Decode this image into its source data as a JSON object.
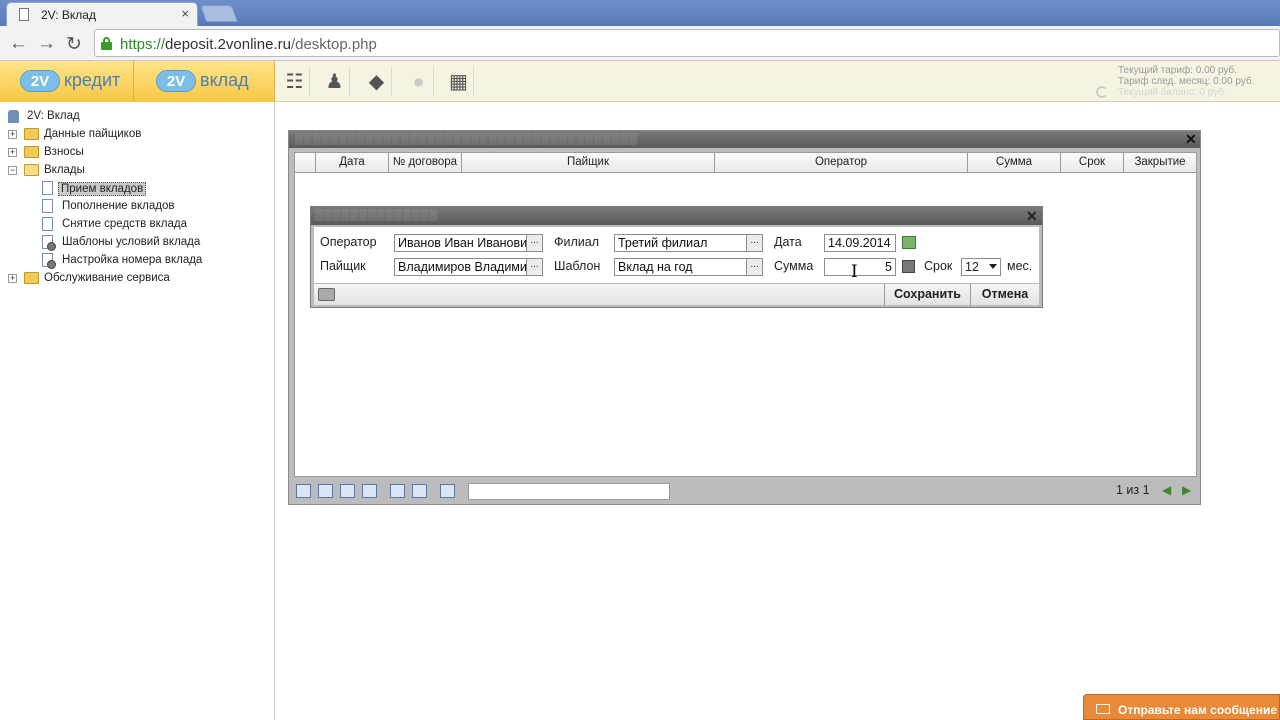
{
  "browser": {
    "tab_title": "2V: Вклад",
    "tab_close": "×",
    "url_protocol": "https://",
    "url_host": "deposit.2vonline.ru",
    "url_path": "/desktop.php"
  },
  "header": {
    "brand_tabs": [
      {
        "logo": "2V",
        "name": "кредит"
      },
      {
        "logo": "2V",
        "name": "вклад"
      }
    ],
    "tariff_lines": [
      "Текущий тариф: 0.00 руб.",
      "Тариф след. месяц: 0.00 руб.",
      "Текущий баланс: 0 руб."
    ]
  },
  "sidebar": {
    "root": "2V: Вклад",
    "items": [
      {
        "label": "Данные пайщиков"
      },
      {
        "label": "Взносы"
      },
      {
        "label": "Вклады"
      },
      {
        "label": "Прием вкладов"
      },
      {
        "label": "Пополнение вкладов"
      },
      {
        "label": "Снятие средств вклада"
      },
      {
        "label": "Шаблоны условий вклада"
      },
      {
        "label": "Настройка номера вклада"
      },
      {
        "label": "Обслуживание сервиса"
      }
    ]
  },
  "grid": {
    "columns": [
      "Дата",
      "№ договора",
      "Пайщик",
      "Оператор",
      "Сумма",
      "Срок",
      "Закрытие"
    ],
    "pager": "1 из 1"
  },
  "dialog": {
    "operator_label": "Оператор",
    "operator_value": "Иванов Иван Иванович",
    "branch_label": "Филиал",
    "branch_value": "Третий филиал",
    "date_label": "Дата",
    "date_value": "14.09.2014",
    "shareholder_label": "Пайщик",
    "shareholder_value": "Владимиров Владимир",
    "template_label": "Шаблон",
    "template_value": "Вклад на год",
    "sum_label": "Сумма",
    "sum_value": "5",
    "term_label": "Срок",
    "term_value": "12",
    "term_unit": "мес.",
    "pick_label": "...",
    "save_label": "Сохранить",
    "cancel_label": "Отмена"
  },
  "feedback": {
    "label": "Отправьте нам сообщение"
  }
}
